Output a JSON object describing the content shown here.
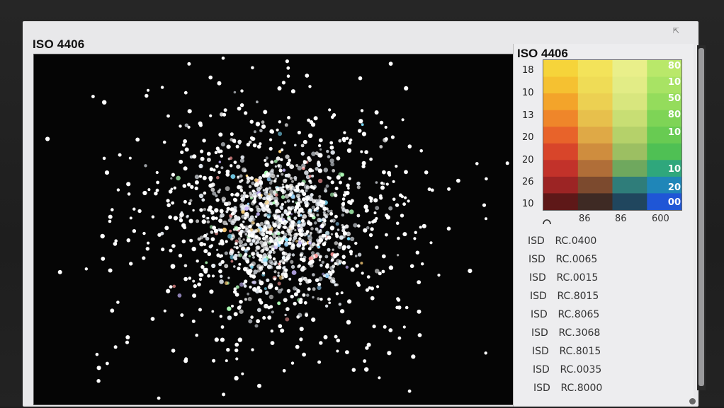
{
  "app": {
    "title": "ISO 4406"
  },
  "side_panel": {
    "title": "ISO 4406",
    "scale": {
      "y_labels": [
        "18",
        "10",
        "13",
        "20",
        "20",
        "26",
        "10"
      ],
      "right_labels": [
        "80",
        "10",
        "50",
        "80",
        "10",
        "10",
        "20",
        "00"
      ],
      "x_labels": [
        "86",
        "86",
        "600"
      ]
    },
    "codes": [
      {
        "prefix": "ISD",
        "value": "RC.0400"
      },
      {
        "prefix": "ISD",
        "value": "RC.0065"
      },
      {
        "prefix": "ISD",
        "value": "RC.0015"
      },
      {
        "prefix": "ISD",
        "value": "RC.8015"
      },
      {
        "prefix": "ISD",
        "value": "RC.8065"
      },
      {
        "prefix": "ISD",
        "value": "RC.3068"
      },
      {
        "prefix": "ISD",
        "value": "RC.8015"
      },
      {
        "prefix": "ISD",
        "value": "RC.0035"
      },
      {
        "prefix": "ISD",
        "value": "RC.8000"
      }
    ]
  },
  "icons": [
    "close-icon",
    "arc-icon"
  ],
  "colors": {
    "scatter_background": "#050505",
    "particle": "#ffffff",
    "scale_low": "#f5c842",
    "scale_mid": "#e8572a",
    "scale_high": "#1f5fd8",
    "scale_green": "#58c95a"
  }
}
